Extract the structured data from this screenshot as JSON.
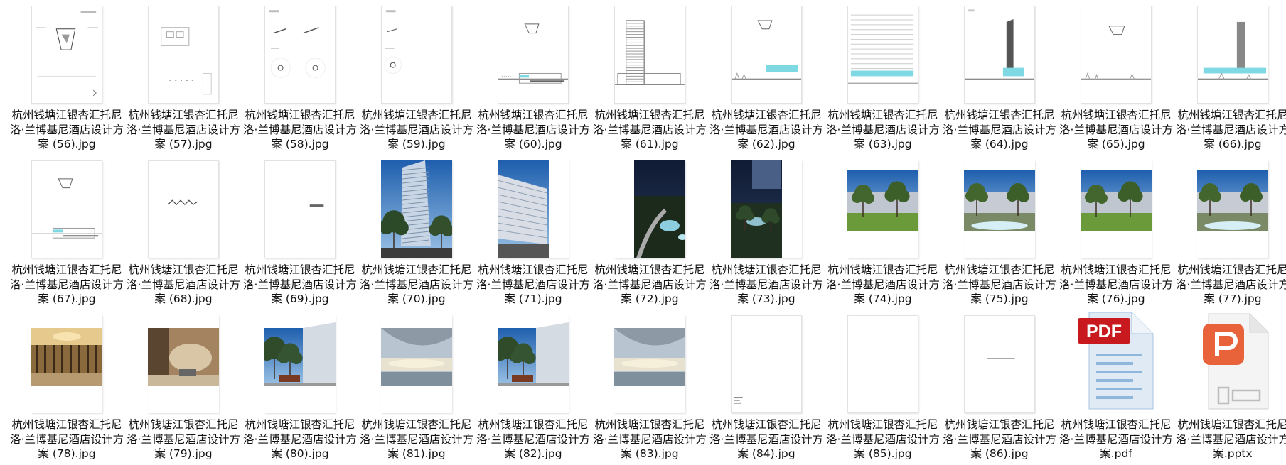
{
  "files": [
    {
      "name": "杭州钱塘江银杏汇托尼洛·兰博基尼酒店设计方案 (56).jpg",
      "thumb": "plan-a"
    },
    {
      "name": "杭州钱塘江银杏汇托尼洛·兰博基尼酒店设计方案 (57).jpg",
      "thumb": "plan-b"
    },
    {
      "name": "杭州钱塘江银杏汇托尼洛·兰博基尼酒店设计方案 (58).jpg",
      "thumb": "detail-circles"
    },
    {
      "name": "杭州钱塘江银杏汇托尼洛·兰博基尼酒店设计方案 (59).jpg",
      "thumb": "detail-circle"
    },
    {
      "name": "杭州钱塘江银杏汇托尼洛·兰博基尼酒店设计方案 (60).jpg",
      "thumb": "section-a"
    },
    {
      "name": "杭州钱塘江银杏汇托尼洛·兰博基尼酒店设计方案 (61).jpg",
      "thumb": "tower-elev"
    },
    {
      "name": "杭州钱塘江银杏汇托尼洛·兰博基尼酒店设计方案 (62).jpg",
      "thumb": "section-b"
    },
    {
      "name": "杭州钱塘江银杏汇托尼洛·兰博基尼酒店设计方案 (63).jpg",
      "thumb": "section-lines"
    },
    {
      "name": "杭州钱塘江银杏汇托尼洛·兰博基尼酒店设计方案 (64).jpg",
      "thumb": "tower-dark"
    },
    {
      "name": "杭州钱塘江银杏汇托尼洛·兰博基尼酒店设计方案 (65).jpg",
      "thumb": "section-c"
    },
    {
      "name": "杭州钱塘江银杏汇托尼洛·兰博基尼酒店设计方案 (66).jpg",
      "thumb": "tower-grey"
    },
    {
      "name": "杭州钱塘江银杏汇托尼洛·兰博基尼酒店设计方案 (67).jpg",
      "thumb": "section-a"
    },
    {
      "name": "杭州钱塘江银杏汇托尼洛·兰博基尼酒店设计方案 (68).jpg",
      "thumb": "zigzag"
    },
    {
      "name": "杭州钱塘江银杏汇托尼洛·兰博基尼酒店设计方案 (69).jpg",
      "thumb": "text-small"
    },
    {
      "name": "杭州钱塘江银杏汇托尼洛·兰博基尼酒店设计方案 (70).jpg",
      "thumb": "render-tower"
    },
    {
      "name": "杭州钱塘江银杏汇托尼洛·兰博基尼酒店设计方案 (71).jpg",
      "thumb": "render-facade"
    },
    {
      "name": "杭州钱塘江银杏汇托尼洛·兰博基尼酒店设计方案 (72).jpg",
      "thumb": "render-night-garden"
    },
    {
      "name": "杭州钱塘江银杏汇托尼洛·兰博基尼酒店设计方案 (73).jpg",
      "thumb": "render-night-plaza"
    },
    {
      "name": "杭州钱塘江银杏汇托尼洛·兰博基尼酒店设计方案 (74).jpg",
      "thumb": "render-lawn"
    },
    {
      "name": "杭州钱塘江银杏汇托尼洛·兰博基尼酒店设计方案 (75).jpg",
      "thumb": "render-pool"
    },
    {
      "name": "杭州钱塘江银杏汇托尼洛·兰博基尼酒店设计方案 (76).jpg",
      "thumb": "render-lawn"
    },
    {
      "name": "杭州钱塘江银杏汇托尼洛·兰博基尼酒店设计方案 (77).jpg",
      "thumb": "render-pool"
    },
    {
      "name": "杭州钱塘江银杏汇托尼洛·兰博基尼酒店设计方案 (78).jpg",
      "thumb": "render-lobby"
    },
    {
      "name": "杭州钱塘江银杏汇托尼洛·兰博基尼酒店设计方案 (79).jpg",
      "thumb": "render-lobby-2"
    },
    {
      "name": "杭州钱塘江银杏汇托尼洛·兰博基尼酒店设计方案 (80).jpg",
      "thumb": "render-street"
    },
    {
      "name": "杭州钱塘江银杏汇托尼洛·兰博基尼酒店设计方案 (81).jpg",
      "thumb": "render-canopy"
    },
    {
      "name": "杭州钱塘江银杏汇托尼洛·兰博基尼酒店设计方案 (82).jpg",
      "thumb": "render-street"
    },
    {
      "name": "杭州钱塘江银杏汇托尼洛·兰博基尼酒店设计方案 (83).jpg",
      "thumb": "render-canopy"
    },
    {
      "name": "杭州钱塘江银杏汇托尼洛·兰博基尼酒店设计方案 (84).jpg",
      "thumb": "blank-note"
    },
    {
      "name": "杭州钱塘江银杏汇托尼洛·兰博基尼酒店设计方案 (85).jpg",
      "thumb": "blank"
    },
    {
      "name": "杭州钱塘江银杏汇托尼洛·兰博基尼酒店设计方案 (86).jpg",
      "thumb": "blank-line"
    },
    {
      "name": "杭州钱塘江银杏汇托尼洛·兰博基尼酒店设计方案.pdf",
      "thumb": "pdf-icon",
      "badge": "PDF"
    },
    {
      "name": "杭州钱塘江银杏汇托尼洛·兰博基尼酒店设计方案.pptx",
      "thumb": "pptx-icon"
    }
  ],
  "colors": {
    "pdf_red": "#c8191e",
    "ppt_orange": "#e8623a",
    "accent_cyan": "#7fd9e3"
  }
}
